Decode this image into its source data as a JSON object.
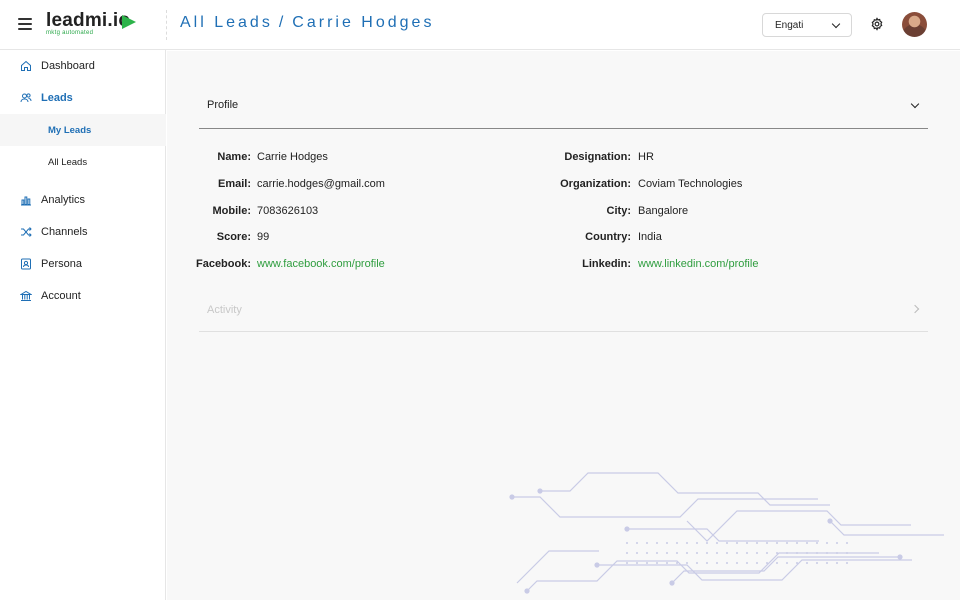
{
  "header": {
    "logo_text": "leadmi.io",
    "logo_tagline": "mktg automated",
    "breadcrumb": [
      "All Leads",
      "Carrie Hodges"
    ],
    "breadcrumb_sep": "/",
    "workspace": "Engati",
    "accent_color": "#1f6fb5",
    "brand_color": "#2db34a"
  },
  "sidebar": {
    "items": [
      {
        "label": "Dashboard",
        "icon": "home-icon"
      },
      {
        "label": "Leads",
        "icon": "users-icon",
        "active": true,
        "children": [
          {
            "label": "My Leads",
            "active": true
          },
          {
            "label": "All Leads"
          }
        ]
      },
      {
        "label": "Analytics",
        "icon": "bar-chart-icon"
      },
      {
        "label": "Channels",
        "icon": "shuffle-icon"
      },
      {
        "label": "Persona",
        "icon": "id-card-icon"
      },
      {
        "label": "Account",
        "icon": "bank-icon"
      }
    ]
  },
  "profile": {
    "section_title": "Profile",
    "left": [
      {
        "key": "Name:",
        "value": "Carrie Hodges"
      },
      {
        "key": "Email:",
        "value": "carrie.hodges@gmail.com"
      },
      {
        "key": "Mobile:",
        "value": "7083626103"
      },
      {
        "key": "Score:",
        "value": "99"
      },
      {
        "key": "Facebook:",
        "value": "www.facebook.com/profile",
        "link": true
      }
    ],
    "right": [
      {
        "key": "Designation:",
        "value": "HR"
      },
      {
        "key": "Organization:",
        "value": "Coviam Technologies"
      },
      {
        "key": "City:",
        "value": "Bangalore"
      },
      {
        "key": "Country:",
        "value": "India"
      },
      {
        "key": "Linkedin:",
        "value": "www.linkedin.com/profile",
        "link": true
      }
    ]
  },
  "activity": {
    "section_title": "Activity"
  }
}
